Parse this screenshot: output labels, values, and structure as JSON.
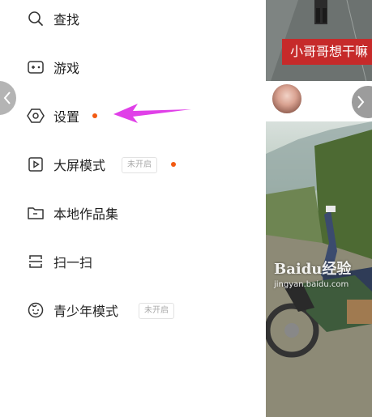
{
  "menu": {
    "items": [
      {
        "id": "search",
        "label": "查找",
        "icon": "search-icon"
      },
      {
        "id": "games",
        "label": "游戏",
        "icon": "gamepad-icon"
      },
      {
        "id": "settings",
        "label": "设置",
        "icon": "settings-hexagon-icon",
        "dot": true
      },
      {
        "id": "bigscreen",
        "label": "大屏模式",
        "icon": "play-screen-icon",
        "badge": "未开启",
        "dot": true
      },
      {
        "id": "local",
        "label": "本地作品集",
        "icon": "folder-icon"
      },
      {
        "id": "scan",
        "label": "扫一扫",
        "icon": "scan-icon"
      },
      {
        "id": "teen",
        "label": "青少年模式",
        "icon": "child-face-icon",
        "badge": "未开启"
      }
    ]
  },
  "feed": {
    "top_card_title": "小哥哥想干嘛",
    "watermark_brand": "Baidu经验",
    "watermark_url": "jingyan.baidu.com"
  },
  "colors": {
    "accent_dot": "#f25a12",
    "arrow": "#e040e8",
    "title_pill": "#c62a2a"
  }
}
